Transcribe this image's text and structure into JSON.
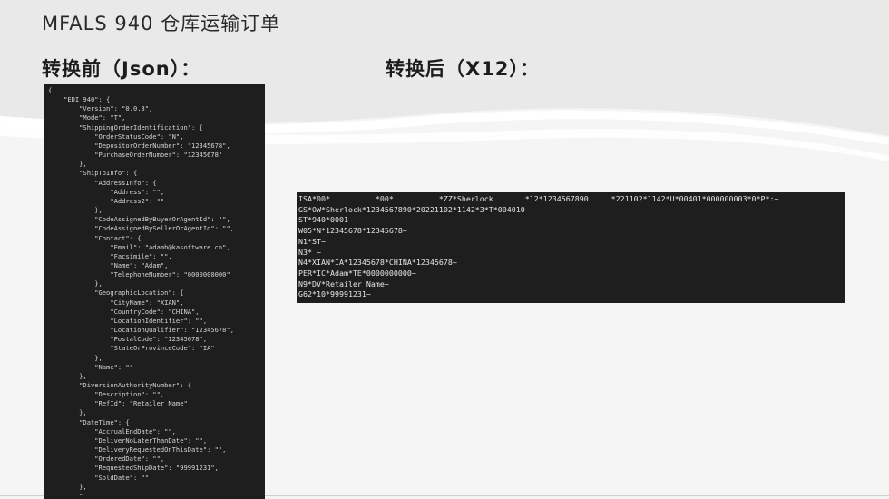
{
  "slide": {
    "title": "MFALS 940 仓库运输订单",
    "before_label": "转换前（Json）：",
    "after_label": "转换后（X12）："
  },
  "json_source": "{\n    \"EDI_940\": {\n        \"Version\": \"0.0.3\",\n        \"Mode\": \"T\",\n        \"ShippingOrderIdentification\": {\n            \"OrderStatusCode\": \"N\",\n            \"DepositorOrderNumber\": \"12345678\",\n            \"PurchaseOrderNumber\": \"12345678\"\n        },\n        \"ShipToInfo\": {\n            \"AddressInfo\": {\n                \"Address\": \"\",\n                \"Address2\": \"\"\n            },\n            \"CodeAssignedByBuyerOrAgentId\": \"\",\n            \"CodeAssignedBySellerOrAgentId\": \"\",\n            \"Contact\": {\n                \"Email\": \"adamb@kasoftware.cn\",\n                \"Facsimile\": \"\",\n                \"Name\": \"Adam\",\n                \"TelephoneNumber\": \"0000000000\"\n            },\n            \"GeographicLocation\": {\n                \"CityName\": \"XIAN\",\n                \"CountryCode\": \"CHINA\",\n                \"LocationIdentifier\": \"\",\n                \"LocationQualifier\": \"12345678\",\n                \"PostalCode\": \"12345678\",\n                \"StateOrProvinceCode\": \"IA\"\n            },\n            \"Name\": \"\"\n        },\n        \"DiversionAuthorityNumber\": {\n            \"Description\": \"\",\n            \"RefId\": \"Retailer Name\"\n        },\n        \"DateTime\": {\n            \"AccrualEndDate\": \"\",\n            \"DeliverNoLaterThanDate\": \"\",\n            \"DeliveryRequestedOnThisDate\": \"\",\n            \"OrderedDate\": \"\",\n            \"RequestedShipDate\": \"99991231\",\n            \"SoldDate\": \"\"\n        },\n        \"",
  "x12_output": "ISA*00*          *00*          *ZZ*Sherlock       *12*1234567890     *221102*1142*U*00401*000000003*0*P*:~\nGS*OW*Sherlock*1234567890*20221102*1142*3*T*004010~\nST*940*0001~\nW05*N*12345678*12345678~\nN1*ST~\nN3* ~\nN4*XIAN*IA*12345678*CHINA*12345678~\nPER*IC*Adam*TE*0000000000~\nN9*DV*Retailer Name~\nG62*10*99991231~"
}
